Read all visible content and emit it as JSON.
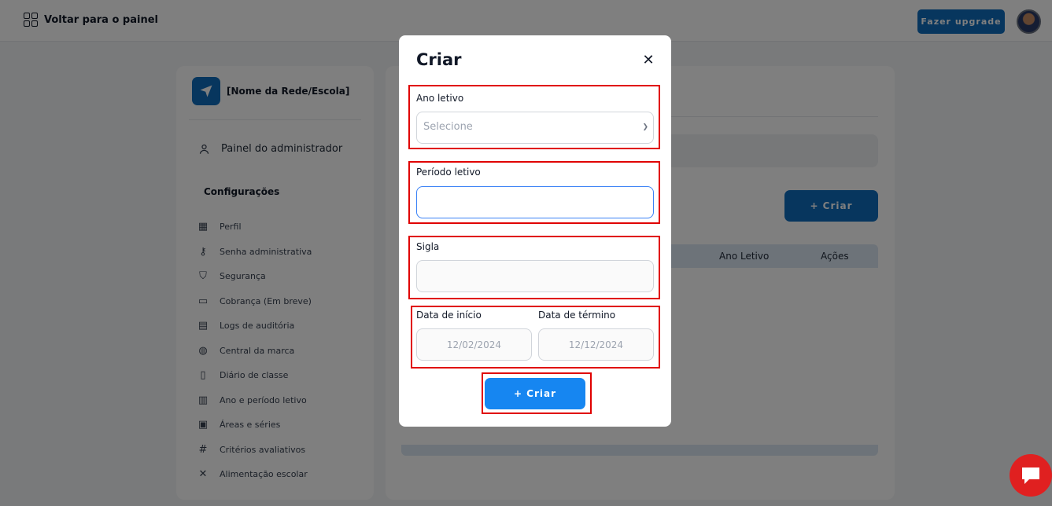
{
  "topbar": {
    "back_label": "Voltar para o painel",
    "upgrade_label": "Fazer upgrade"
  },
  "sidebar": {
    "org_name": "[Nome da Rede/Escola]",
    "admin_label": "Painel do administrador",
    "section_title": "Configurações",
    "items": [
      {
        "label": "Perfil",
        "icon": "profile-icon"
      },
      {
        "label": "Senha administrativa",
        "icon": "key-icon"
      },
      {
        "label": "Segurança",
        "icon": "shield-icon"
      },
      {
        "label": "Cobrança (Em breve)",
        "icon": "billing-icon"
      },
      {
        "label": "Logs de auditória",
        "icon": "audit-log-icon"
      },
      {
        "label": "Central da marca",
        "icon": "palette-icon"
      },
      {
        "label": "Diário de classe",
        "icon": "notebook-icon"
      },
      {
        "label": "Ano e período letivo",
        "icon": "calendar-icon"
      },
      {
        "label": "Áreas e séries",
        "icon": "areas-icon"
      },
      {
        "label": "Critérios avaliativos",
        "icon": "hash-icon"
      },
      {
        "label": "Alimentação escolar",
        "icon": "utensils-icon"
      }
    ]
  },
  "main": {
    "create_label": "+ Criar",
    "table_headers": [
      "Ano Letivo",
      "Ações"
    ]
  },
  "modal": {
    "title": "Criar",
    "close_symbol": "✕",
    "ano_letivo": {
      "label": "Ano letivo",
      "placeholder": "Selecione"
    },
    "periodo_letivo": {
      "label": "Período letivo",
      "value": ""
    },
    "sigla": {
      "label": "Sigla",
      "value": ""
    },
    "data_inicio": {
      "label": "Data de início",
      "placeholder": "12/02/2024"
    },
    "data_termino": {
      "label": "Data de término",
      "placeholder": "12/12/2024"
    },
    "create_label": "+ Criar"
  },
  "colors": {
    "primary": "#0f6cbd",
    "modal_button": "#1686f1",
    "highlight": "#e00000",
    "chat": "#e02020"
  }
}
